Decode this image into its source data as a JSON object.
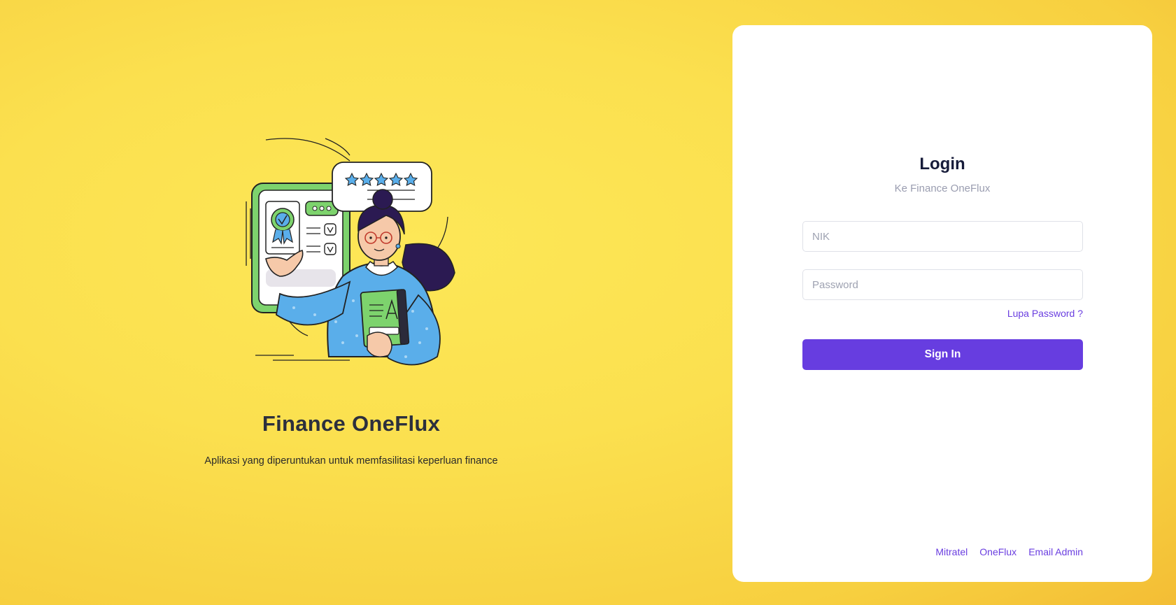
{
  "brand": {
    "title": "Finance OneFlux",
    "subtitle": "Aplikasi yang diperuntukan untuk memfasilitasi keperluan finance"
  },
  "login": {
    "title": "Login",
    "subtitle": "Ke Finance OneFlux",
    "nik_placeholder": "NIK",
    "password_placeholder": "Password",
    "forgot_label": "Lupa Password ?",
    "signin_label": "Sign In"
  },
  "footer": {
    "links": [
      "Mitratel",
      "OneFlux",
      "Email Admin"
    ]
  },
  "colors": {
    "accent": "#673de0",
    "background": "#fbe04f",
    "title": "#171c3a"
  },
  "illustration": {
    "rating_stars": 5
  }
}
